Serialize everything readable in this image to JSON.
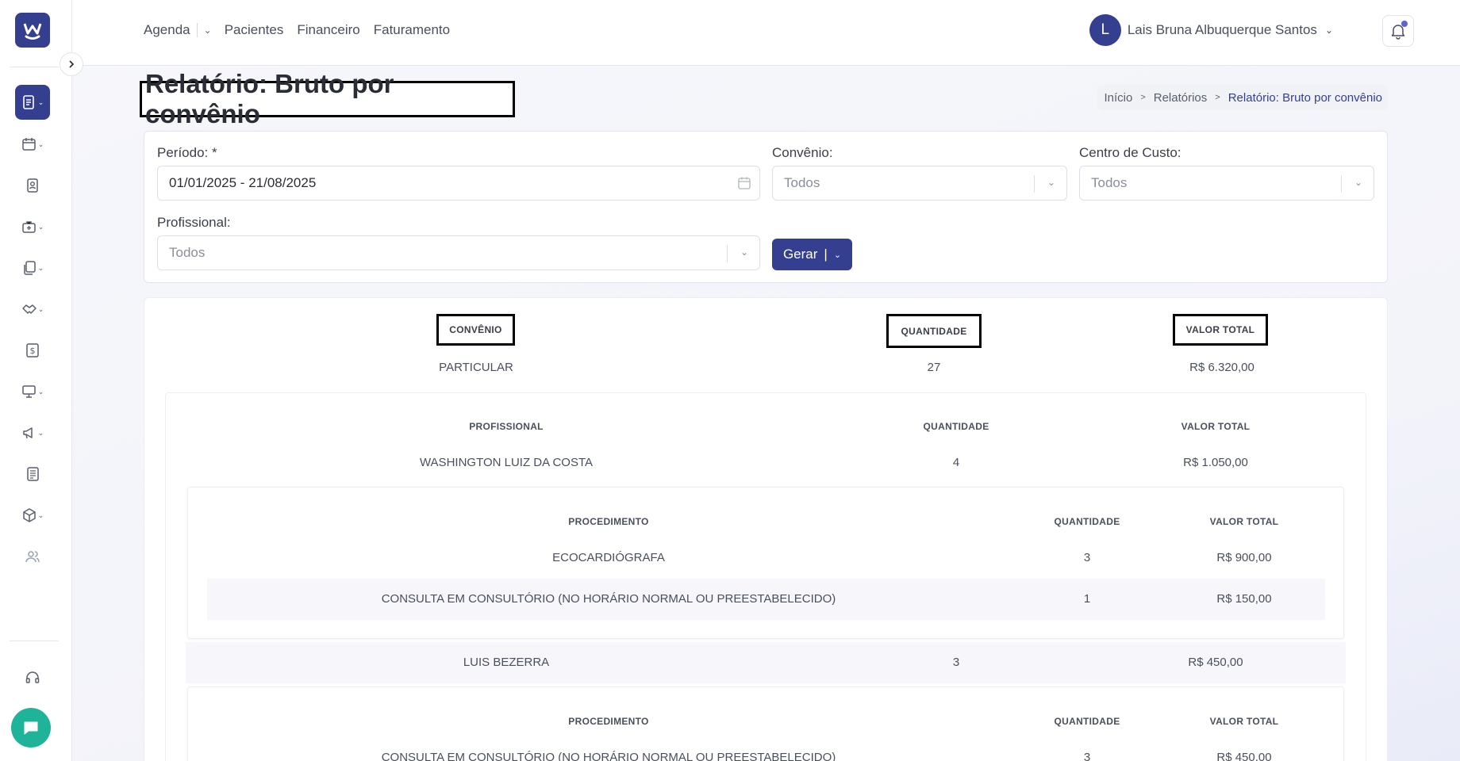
{
  "topnav": {
    "agenda": "Agenda",
    "pacientes": "Pacientes",
    "financeiro": "Financeiro",
    "faturamento": "Faturamento"
  },
  "user": {
    "initial": "L",
    "name": "Lais Bruna Albuquerque Santos"
  },
  "page": {
    "title": "Relatório: Bruto por convênio"
  },
  "breadcrumb": {
    "home": "Início",
    "reports": "Relatórios",
    "current": "Relatório: Bruto por convênio"
  },
  "filters": {
    "periodo_label": "Período: *",
    "periodo_value": "01/01/2025 - 21/08/2025",
    "convenio_label": "Convênio:",
    "convenio_value": "Todos",
    "centro_label": "Centro de Custo:",
    "centro_value": "Todos",
    "profissional_label": "Profissional:",
    "profissional_value": "Todos",
    "generate_label": "Gerar"
  },
  "report": {
    "headers": {
      "convenio": "CONVÊNIO",
      "quantidade": "QUANTIDADE",
      "valor_total": "VALOR TOTAL"
    },
    "convenio_row": {
      "name": "PARTICULAR",
      "qty": "27",
      "total": "R$ 6.320,00"
    },
    "prof_headers": {
      "profissional": "PROFISSIONAL",
      "quantidade": "QUANTIDADE",
      "valor_total": "VALOR TOTAL"
    },
    "proc_headers": {
      "procedimento": "PROCEDIMENTO",
      "quantidade": "QUANTIDADE",
      "valor_total": "VALOR TOTAL"
    },
    "professionals": [
      {
        "name": "WASHINGTON LUIZ DA COSTA",
        "qty": "4",
        "total": "R$ 1.050,00",
        "procedures": [
          {
            "name": "ECOCARDIÓGRAFA",
            "qty": "3",
            "total": "R$ 900,00"
          },
          {
            "name": "CONSULTA EM CONSULTÓRIO (NO HORÁRIO NORMAL OU PREESTABELECIDO)",
            "qty": "1",
            "total": "R$ 150,00"
          }
        ]
      },
      {
        "name": "LUIS BEZERRA",
        "qty": "3",
        "total": "R$ 450,00",
        "procedures": [
          {
            "name": "CONSULTA EM CONSULTÓRIO (NO HORÁRIO NORMAL OU PREESTABELECIDO)",
            "qty": "3",
            "total": "R$ 450,00"
          }
        ]
      }
    ]
  }
}
